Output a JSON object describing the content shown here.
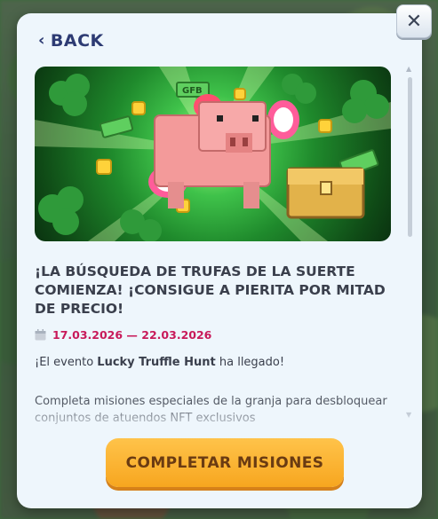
{
  "dialog": {
    "back_label": "BACK",
    "close_symbol": "✕"
  },
  "banner": {
    "coupon_text": "GFB"
  },
  "news": {
    "title": "¡LA BÚSQUEDA DE TRUFAS DE LA SUERTE COMIENZA! ¡CONSIGUE A PIERITA POR MITAD DE PRECIO!",
    "date_range": "17.03.2026 — 22.03.2026",
    "intro_prefix": "¡El evento ",
    "intro_event": "Lucky Truffle Hunt",
    "intro_suffix": " ha llegado!",
    "body_partial": "Completa misiones especiales de la granja para desbloquear conjuntos de atuendos NFT exclusivos"
  },
  "cta": {
    "label": "COMPLETAR MISIONES"
  },
  "colors": {
    "title": "#3a3f4c",
    "date": "#c81a5a",
    "back": "#2d3b73",
    "cta": "#f7a61f"
  }
}
